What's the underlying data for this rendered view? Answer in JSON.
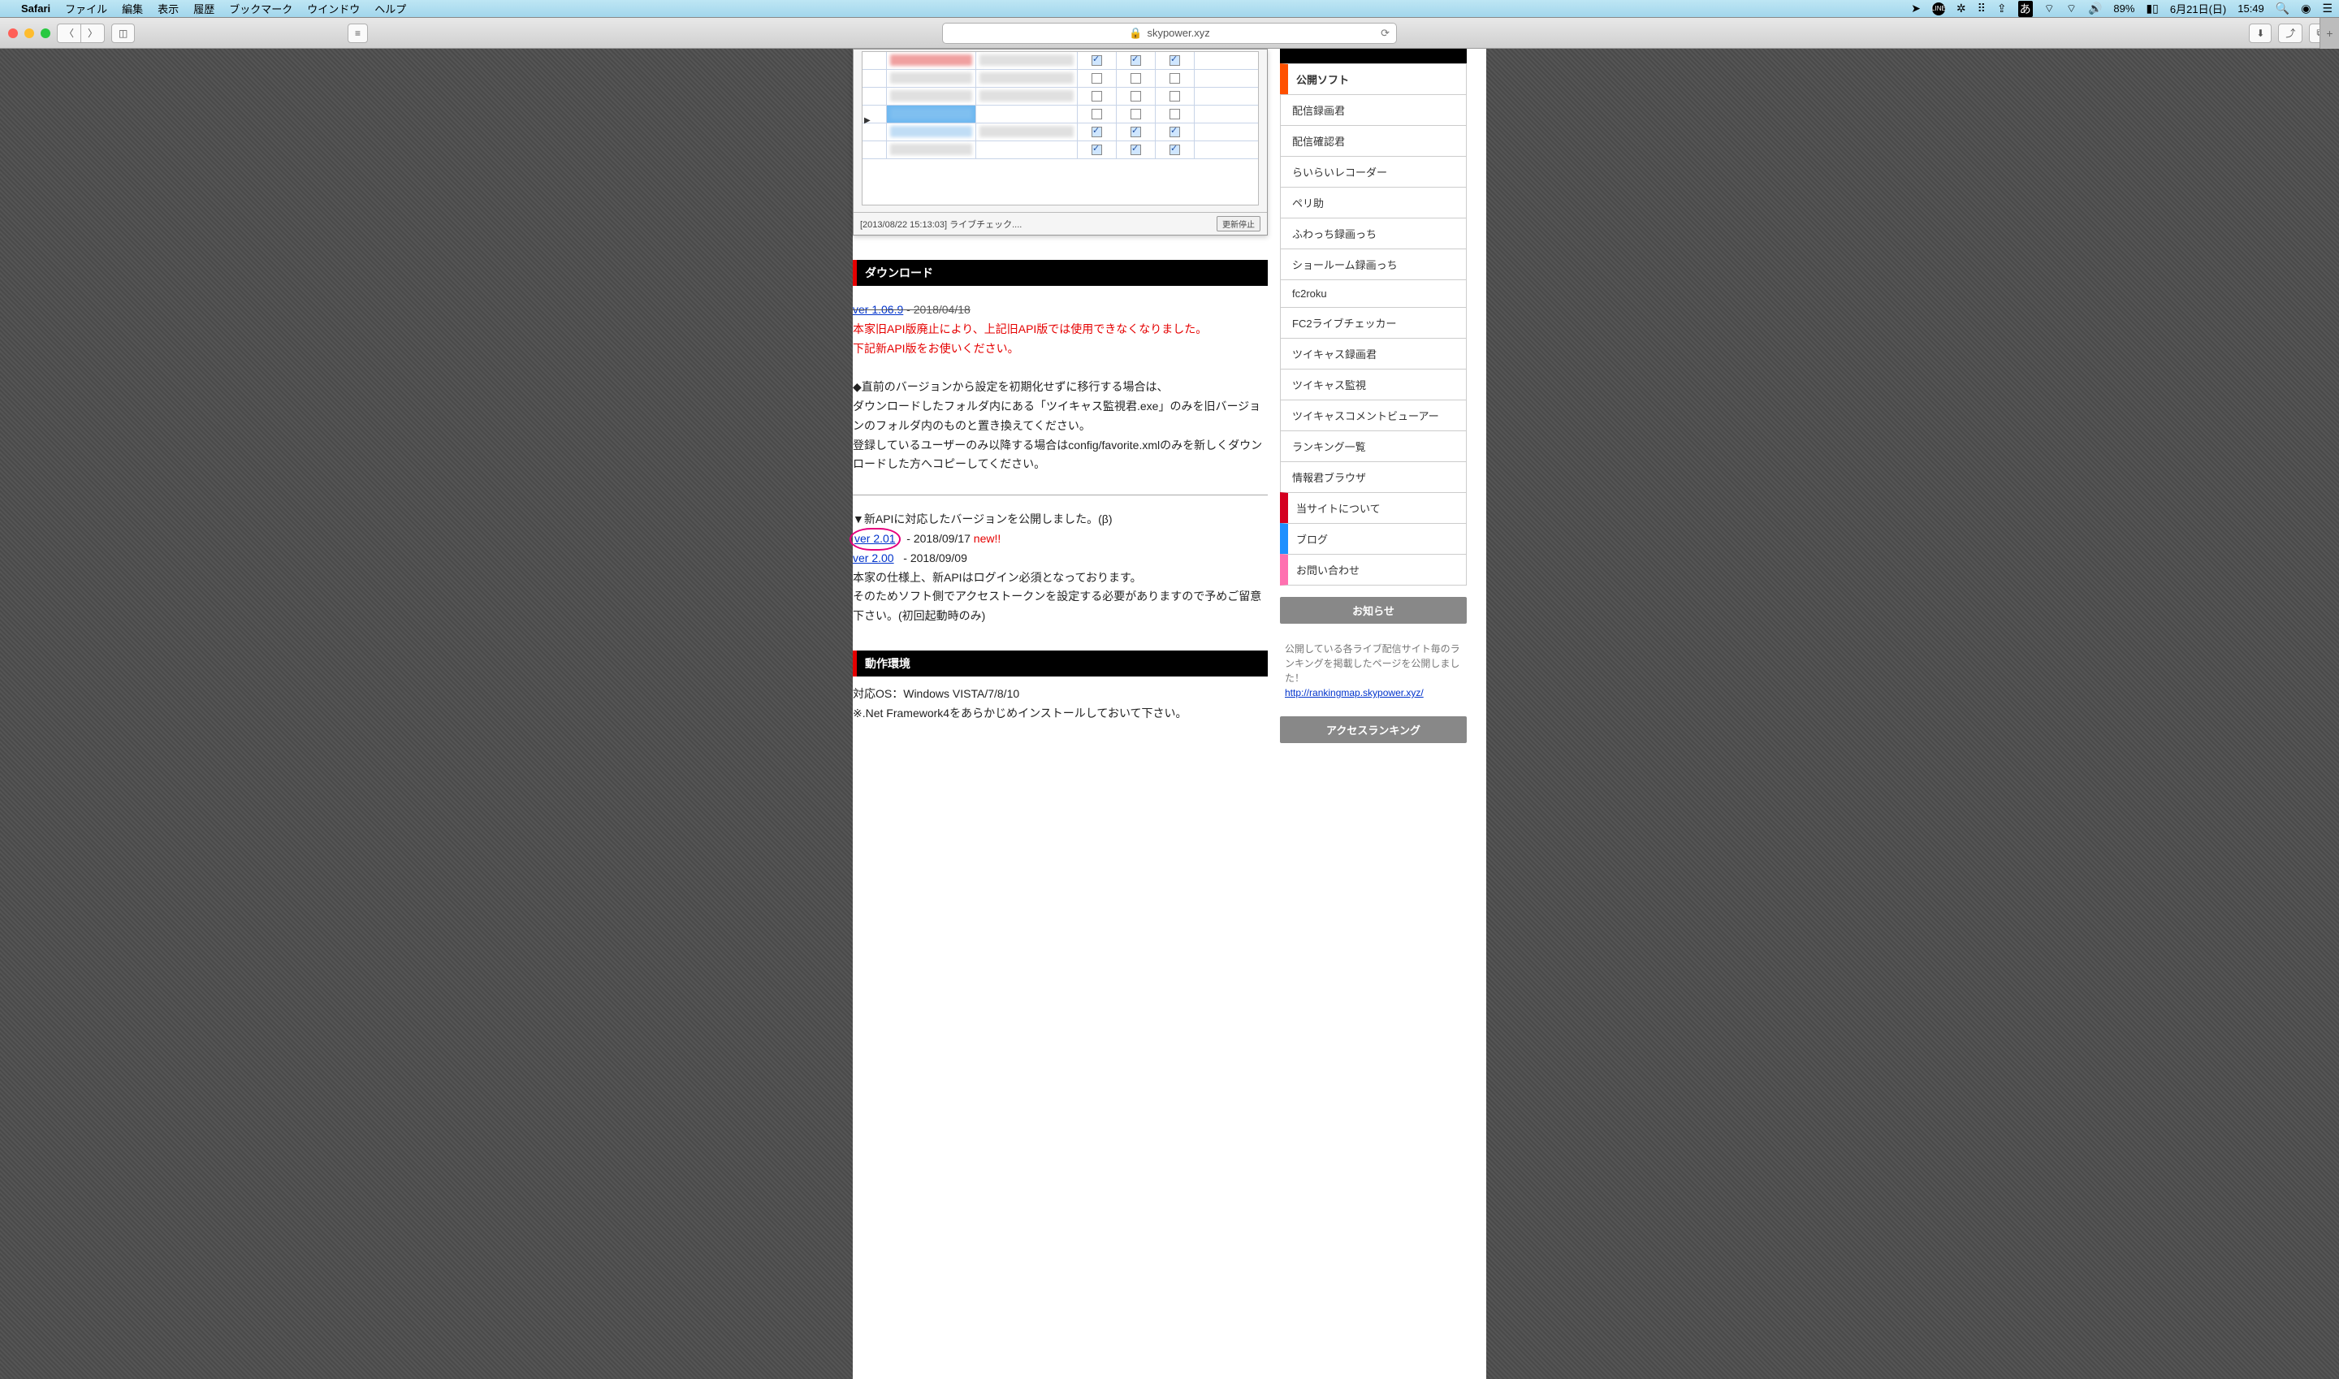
{
  "menubar": {
    "app": "Safari",
    "items": [
      "ファイル",
      "編集",
      "表示",
      "履歴",
      "ブックマーク",
      "ウインドウ",
      "ヘルプ"
    ],
    "battery": "89%",
    "date": "6月21日(日)",
    "time": "15:49",
    "ime": "あ"
  },
  "toolbar": {
    "url": "skypower.xyz"
  },
  "app_shot": {
    "status_text": "[2013/08/22 15:13:03] ライブチェック....",
    "stop_btn": "更新停止"
  },
  "sections": {
    "download": "ダウンロード",
    "env": "動作環境"
  },
  "download": {
    "old_ver_link": "ver 1.06.9",
    "old_ver_date": " - 2018/04/18",
    "deprecated1": "本家旧API版廃止により、上記旧API版では使用できなくなりました。",
    "deprecated2": "下記新API版をお使いください。",
    "migrate1": "◆直前のバージョンから設定を初期化せずに移行する場合は、",
    "migrate2": "ダウンロードしたフォルダ内にある「ツイキャス監視君.exe」のみを旧バージョンのフォルダ内のものと置き換えてください。",
    "migrate3": "登録しているユーザーのみ以降する場合はconfig/favorite.xmlのみを新しくダウンロードした方へコピーしてください。",
    "new_heading": "▼新APIに対応したバージョンを公開しました。(β)",
    "v201_link": "ver 2.01",
    "v201_date": "   - 2018/09/17 ",
    "v201_new": "new!!",
    "v200_link": "ver 2.00",
    "v200_date": "   - 2018/09/09",
    "note1": "本家の仕様上、新APIはログイン必須となっております。",
    "note2": "そのためソフト側でアクセストークンを設定する必要がありますので予めご留意下さい。(初回起動時のみ)"
  },
  "env": {
    "os": "対応OS：Windows VISTA/7/8/10",
    "net": "※.Net Framework4をあらかじめインストールしておいて下さい。"
  },
  "sidebar": {
    "items": [
      {
        "label": "公開ソフト",
        "cls": "accent-orange"
      },
      {
        "label": "配信録画君",
        "cls": ""
      },
      {
        "label": "配信確認君",
        "cls": ""
      },
      {
        "label": "らいらいレコーダー",
        "cls": ""
      },
      {
        "label": "ペリ助",
        "cls": ""
      },
      {
        "label": "ふわっち録画っち",
        "cls": ""
      },
      {
        "label": "ショールーム録画っち",
        "cls": ""
      },
      {
        "label": "fc2roku",
        "cls": ""
      },
      {
        "label": "FC2ライブチェッカー",
        "cls": ""
      },
      {
        "label": "ツイキャス録画君",
        "cls": ""
      },
      {
        "label": "ツイキャス監視",
        "cls": ""
      },
      {
        "label": "ツイキャスコメントビューアー",
        "cls": ""
      },
      {
        "label": "ランキング一覧",
        "cls": ""
      },
      {
        "label": "情報君ブラウザ",
        "cls": ""
      },
      {
        "label": "当サイトについて",
        "cls": "accent-red"
      },
      {
        "label": "ブログ",
        "cls": "accent-blue"
      },
      {
        "label": "お問い合わせ",
        "cls": "accent-pink"
      }
    ],
    "news_head": "お知らせ",
    "news_text": "公開している各ライブ配信サイト毎のランキングを掲載したページを公開しました！",
    "news_link": "http://rankingmap.skypower.xyz/",
    "rank_head": "アクセスランキング"
  }
}
